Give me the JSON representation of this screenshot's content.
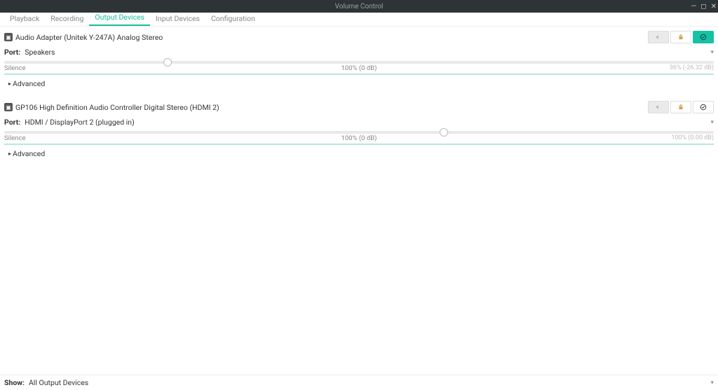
{
  "window": {
    "title": "Volume Control"
  },
  "tabs": [
    {
      "label": "Playback"
    },
    {
      "label": "Recording"
    },
    {
      "label": "Output Devices",
      "active": true
    },
    {
      "label": "Input Devices"
    },
    {
      "label": "Configuration"
    }
  ],
  "devices": [
    {
      "name": "Audio Adapter (Unitek Y-247A) Analog Stereo",
      "port_label": "Port:",
      "port_value": "Speakers",
      "slider_percent": 23,
      "labels": {
        "silence": "Silence",
        "center": "100% (0 dB)",
        "right": "36% (-26.32 dB)"
      },
      "advanced": "Advanced",
      "fallback_active": true
    },
    {
      "name": "GP106 High Definition Audio Controller Digital Stereo (HDMI 2)",
      "port_label": "Port:",
      "port_value": "HDMI / DisplayPort 2 (plugged in)",
      "slider_percent": 62,
      "labels": {
        "silence": "Silence",
        "center": "100% (0 dB)",
        "right": "100% (0.00 dB)"
      },
      "advanced": "Advanced",
      "fallback_active": false
    }
  ],
  "footer": {
    "show_label": "Show:",
    "show_value": "All Output Devices"
  }
}
